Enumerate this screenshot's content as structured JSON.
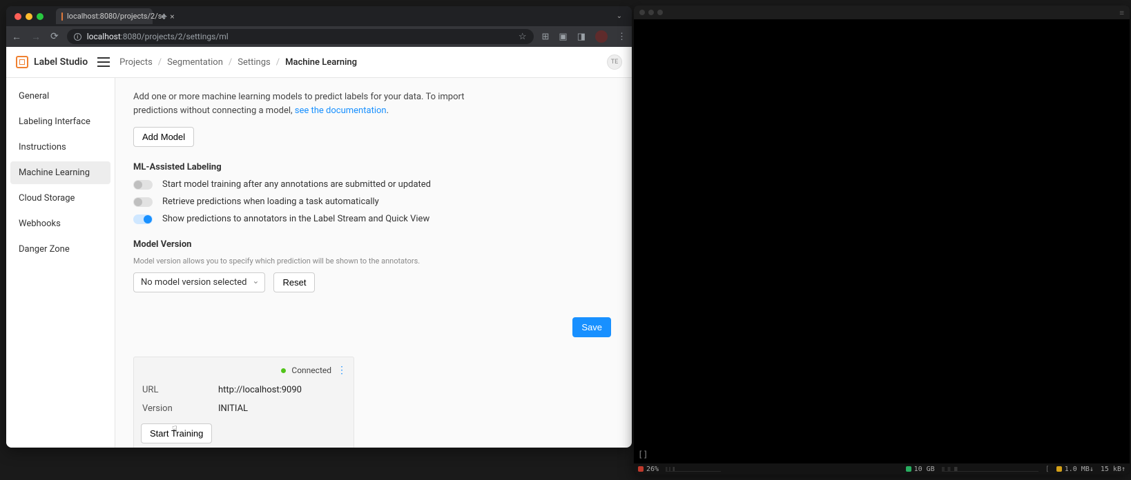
{
  "browser": {
    "tab_title": "localhost:8080/projects/2/se",
    "url_host": "localhost",
    "url_port_path": ":8080/projects/2/settings/ml"
  },
  "app": {
    "brand": "Label Studio",
    "breadcrumbs": [
      "Projects",
      "Segmentation",
      "Settings",
      "Machine Learning"
    ],
    "user_initials": "TE"
  },
  "sidebar": {
    "items": [
      "General",
      "Labeling Interface",
      "Instructions",
      "Machine Learning",
      "Cloud Storage",
      "Webhooks",
      "Danger Zone"
    ],
    "active_index": 3
  },
  "main": {
    "intro_text": "Add one or more machine learning models to predict labels for your data. To import predictions without connecting a model, ",
    "intro_link": "see the documentation",
    "add_model_label": "Add Model",
    "ml_heading": "ML-Assisted Labeling",
    "toggles": [
      {
        "on": false,
        "label": "Start model training after any annotations are submitted or updated"
      },
      {
        "on": false,
        "label": "Retrieve predictions when loading a task automatically"
      },
      {
        "on": true,
        "label": "Show predictions to annotators in the Label Stream and Quick View"
      }
    ],
    "model_version_heading": "Model Version",
    "model_version_hint": "Model version allows you to specify which prediction will be shown to the annotators.",
    "model_version_selected": "No model version selected",
    "reset_label": "Reset",
    "save_label": "Save"
  },
  "ml_card": {
    "status": "Connected",
    "url_label": "URL",
    "url_value": "http://localhost:9090",
    "version_label": "Version",
    "version_value": "INITIAL",
    "start_training_label": "Start Training"
  },
  "terminal": {
    "prompt": "[]",
    "cpu": "26%",
    "mem": "10 GB",
    "net_down": "1.0 MB↓",
    "net_up": "15 kB↑"
  }
}
